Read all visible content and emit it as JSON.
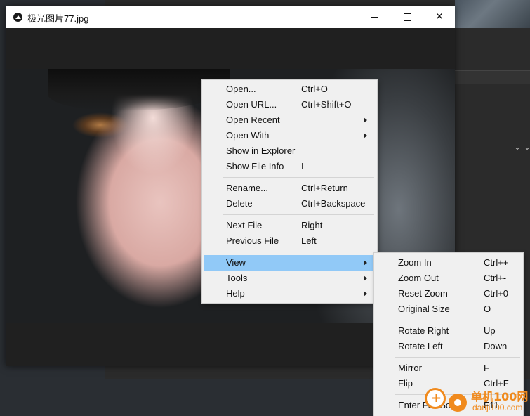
{
  "window": {
    "title": "极光图片77.jpg"
  },
  "context_menu": {
    "items": [
      {
        "label": "Open...",
        "shortcut": "Ctrl+O"
      },
      {
        "label": "Open URL...",
        "shortcut": "Ctrl+Shift+O"
      },
      {
        "label": "Open Recent",
        "submenu": true
      },
      {
        "label": "Open With",
        "submenu": true
      },
      {
        "label": "Show in Explorer"
      },
      {
        "label": "Show File Info",
        "shortcut": "I"
      },
      {
        "label": "Rename...",
        "shortcut": "Ctrl+Return"
      },
      {
        "label": "Delete",
        "shortcut": "Ctrl+Backspace"
      },
      {
        "label": "Next File",
        "shortcut": "Right"
      },
      {
        "label": "Previous File",
        "shortcut": "Left"
      },
      {
        "label": "View",
        "submenu": true,
        "active": true
      },
      {
        "label": "Tools",
        "submenu": true
      },
      {
        "label": "Help",
        "submenu": true
      }
    ]
  },
  "view_submenu": {
    "items": [
      {
        "label": "Zoom In",
        "shortcut": "Ctrl++"
      },
      {
        "label": "Zoom Out",
        "shortcut": "Ctrl+-"
      },
      {
        "label": "Reset Zoom",
        "shortcut": "Ctrl+0"
      },
      {
        "label": "Original Size",
        "shortcut": "O"
      },
      {
        "label": "Rotate Right",
        "shortcut": "Up"
      },
      {
        "label": "Rotate Left",
        "shortcut": "Down"
      },
      {
        "label": "Mirror",
        "shortcut": "F"
      },
      {
        "label": "Flip",
        "shortcut": "Ctrl+F"
      },
      {
        "label": "Enter Full Sc",
        "shortcut": "F11"
      }
    ]
  },
  "watermark": {
    "cn": "单机100网",
    "en": "danji100.com"
  },
  "colors": {
    "menu_bg": "#f0f0f0",
    "menu_highlight": "#91c9f7",
    "viewer_bg": "#202020",
    "watermark_orange": "#f08a1d"
  },
  "icons": {
    "app": "viewer-app-icon",
    "minimize": "minimize-icon",
    "maximize": "maximize-icon",
    "close": "close-icon",
    "submenu": "chevron-right-icon"
  }
}
